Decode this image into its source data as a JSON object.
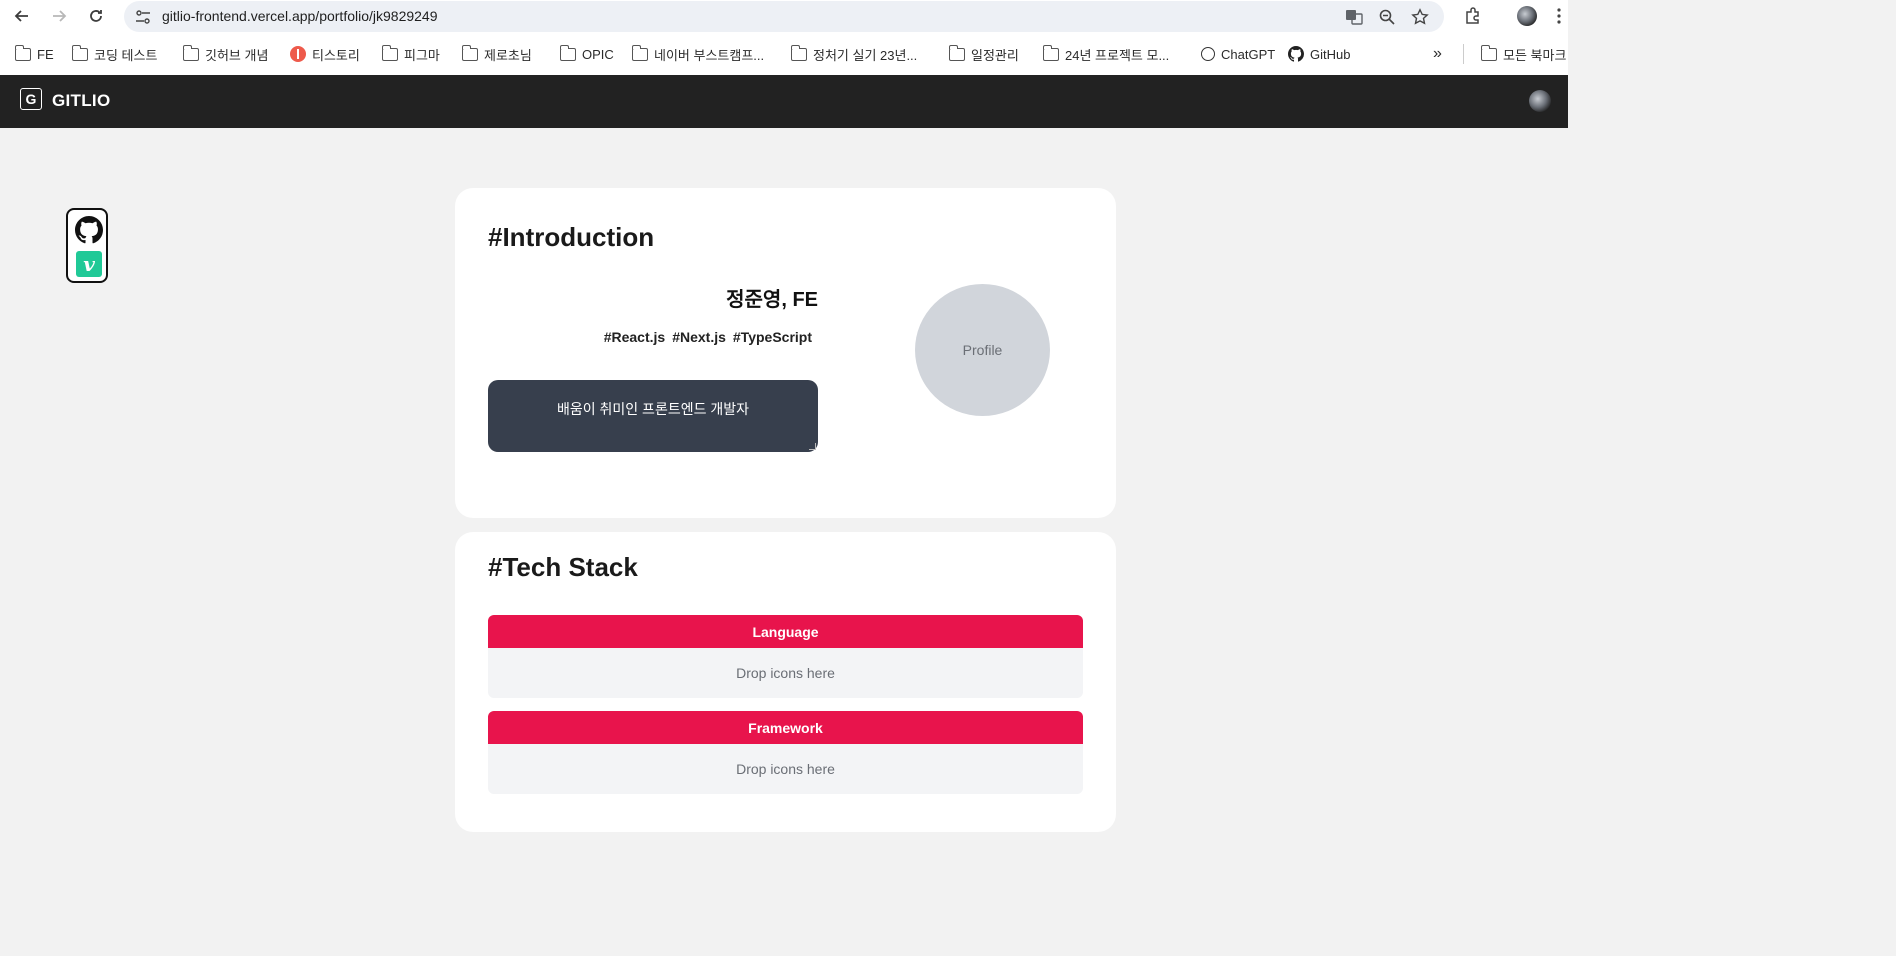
{
  "browser": {
    "url": "gitlio-frontend.vercel.app/portfolio/jk9829249",
    "bookmarks": [
      {
        "label": "FE",
        "icon": "folder-icon"
      },
      {
        "label": "코딩 테스트",
        "icon": "folder-icon"
      },
      {
        "label": "깃허브 개념",
        "icon": "folder-icon"
      },
      {
        "label": "티스토리",
        "icon": "tistory-icon"
      },
      {
        "label": "피그마",
        "icon": "folder-icon"
      },
      {
        "label": "제로초님",
        "icon": "folder-icon"
      },
      {
        "label": "OPIC",
        "icon": "folder-icon"
      },
      {
        "label": "네이버 부스트캠프...",
        "icon": "folder-icon"
      },
      {
        "label": "정처기 실기 23년...",
        "icon": "folder-icon"
      },
      {
        "label": "일정관리",
        "icon": "folder-icon"
      },
      {
        "label": "24년 프로젝트 모...",
        "icon": "folder-icon"
      },
      {
        "label": "ChatGPT",
        "icon": "chatgpt-icon"
      },
      {
        "label": "GitHub",
        "icon": "github-icon"
      }
    ],
    "overflow_label": "»",
    "all_bookmarks_label": "모든 북마크"
  },
  "app": {
    "logo_letter": "G",
    "logo_text": "GITLIO"
  },
  "intro": {
    "title": "#Introduction",
    "name": "정준영, FE",
    "tags": [
      "#React.js",
      "#Next.js",
      "#TypeScript"
    ],
    "bio": "배움이 취미인 프론트엔드 개발자",
    "profile_placeholder": "Profile"
  },
  "tech": {
    "title": "#Tech Stack",
    "sections": [
      {
        "label": "Language",
        "drop_text": "Drop icons here"
      },
      {
        "label": "Framework",
        "drop_text": "Drop icons here"
      }
    ]
  },
  "colors": {
    "header_bg": "#222222",
    "accent": "#e8144c",
    "bio_bg": "#373f4d",
    "velog_green": "#20c997"
  }
}
